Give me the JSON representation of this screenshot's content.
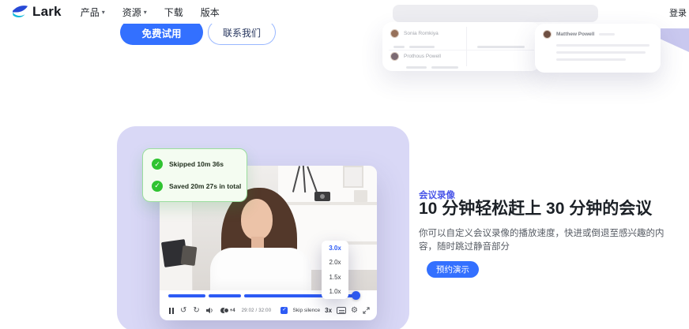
{
  "nav": {
    "brand": "Lark",
    "items": [
      {
        "label": "产品",
        "has_dropdown": true
      },
      {
        "label": "资源",
        "has_dropdown": true
      },
      {
        "label": "下载",
        "has_dropdown": false
      },
      {
        "label": "版本",
        "has_dropdown": false
      }
    ],
    "login_label": "登录"
  },
  "hero": {
    "primary_button": "免费试用",
    "secondary_button": "联系我们"
  },
  "preview": {
    "rows": [
      {
        "name": "Sonia Romkiya"
      },
      {
        "name": "Prothous Powell"
      }
    ],
    "message": {
      "name": "Matthew Powell"
    }
  },
  "badges": {
    "items": [
      {
        "label": "Skipped 10m 36s"
      },
      {
        "label": "Saved 20m 27s in total"
      }
    ]
  },
  "speed_menu": {
    "selected": "3.0x",
    "options": [
      "3.0x",
      "2.0x",
      "1.5x",
      "1.0x"
    ]
  },
  "player": {
    "time": "29:02 / 32:00",
    "skip_silence_label": "Skip silence",
    "skip_silence_checked": true,
    "speed_label": "3x",
    "participants_more": "+4",
    "progress_percent": 96
  },
  "feature": {
    "eyebrow": "会议录像",
    "title": "10 分钟轻松赶上 30 分钟的会议",
    "description": "你可以自定义会议录像的播放速度，快进或倒退至感兴趣的内容，随时跳过静音部分",
    "cta": "预约演示"
  },
  "icons": {
    "caret_down": "▾",
    "check": "✓",
    "gear": "⚙",
    "replay_back": "↺",
    "replay_forward": "↻"
  },
  "colors": {
    "accent_blue": "#3370ff",
    "player_blue": "#2d5bf5",
    "eyebrow_indigo": "#4955e8",
    "success_green": "#2fc331",
    "lavender": "#d9d8f6"
  }
}
